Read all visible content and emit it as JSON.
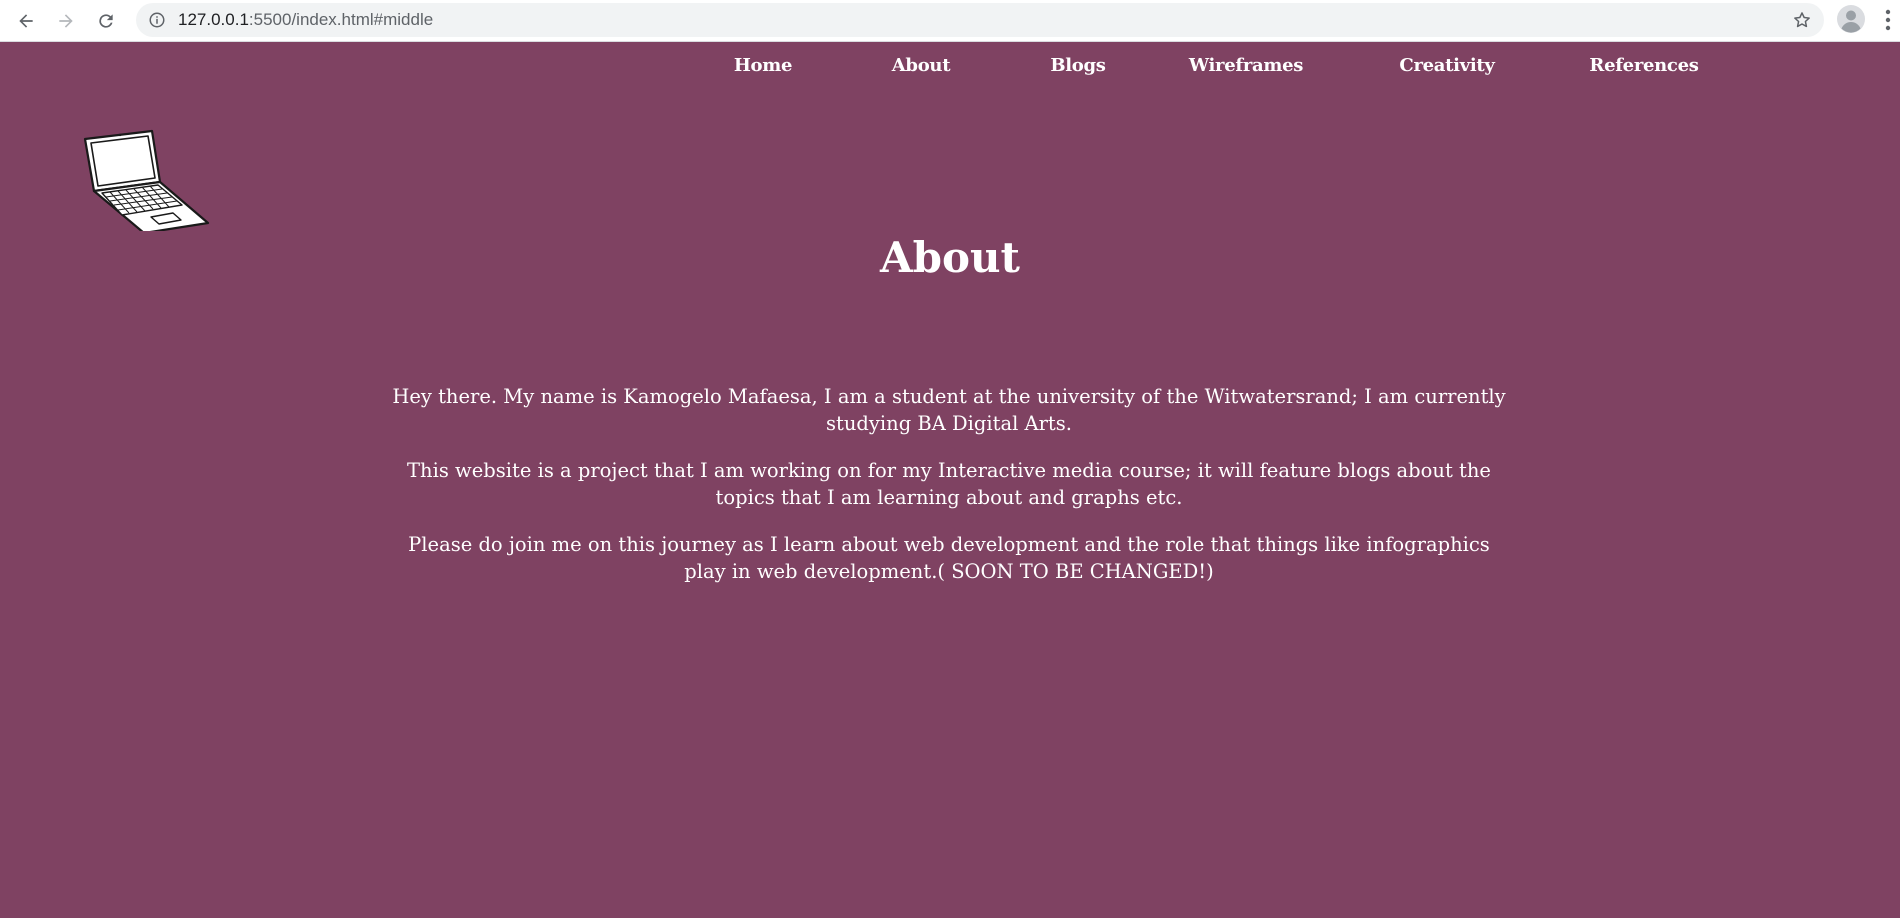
{
  "browser": {
    "url_host": "127.0.0.1",
    "url_rest": ":5500/index.html#middle"
  },
  "nav": [
    {
      "label": "Home"
    },
    {
      "label": "About"
    },
    {
      "label": "Blogs"
    },
    {
      "label": "Wireframes"
    },
    {
      "label": "Creativity"
    },
    {
      "label": "References"
    }
  ],
  "main": {
    "title": "About",
    "paragraphs": [
      "Hey there. My name is Kamogelo Mafaesa, I am a student at the university of the Witwatersrand; I am currently studying BA Digital Arts.",
      "This website is a project that I am working on for my Interactive media course; it will feature blogs about the topics that I am learning about and graphs etc.",
      "Please do join me on this journey as I learn about web development and the role that things like infographics play in web development.( SOON TO BE CHANGED!)"
    ]
  },
  "colors": {
    "background": "#7f4262",
    "text": "#ffffff"
  },
  "icons": {
    "logo": "laptop-icon",
    "back": "back-arrow-icon",
    "forward": "forward-arrow-icon",
    "reload": "reload-icon",
    "info": "info-icon",
    "bookmark": "star-icon",
    "profile": "profile-icon",
    "menu": "more-vert-icon"
  }
}
